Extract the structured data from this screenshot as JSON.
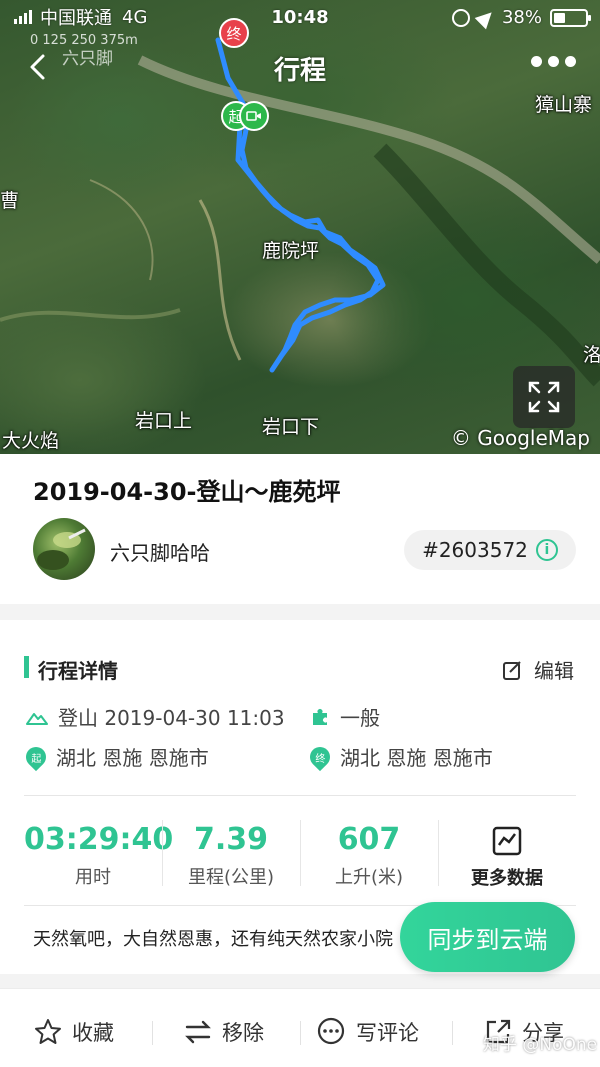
{
  "status_bar": {
    "carrier": "中国联通",
    "network": "4G",
    "time": "10:48",
    "battery": "38%",
    "battery_level": 0.38
  },
  "nav": {
    "title": "行程"
  },
  "map": {
    "scale_ticks": "0    125    250    375m",
    "scale_label": "六只脚",
    "places": [
      "獐山寨",
      "鹿院坪",
      "岩口上",
      "岩口下",
      "大火焰",
      "洛",
      "曹"
    ],
    "start_marker": "起",
    "end_marker": "终",
    "attribution": "© GoogleMap"
  },
  "trip": {
    "title": "2019-04-30-登山～鹿苑坪",
    "user_name": "六只脚哈哈",
    "trip_id": "#2603572"
  },
  "details": {
    "section_title": "行程详情",
    "edit_label": "编辑",
    "activity": "登山 2019-04-30 11:03",
    "difficulty": "一般",
    "start_location": "湖北 恩施 恩施市",
    "end_location": "湖北 恩施 恩施市",
    "start_badge": "起",
    "end_badge": "终",
    "stats": [
      {
        "value": "03:29:40",
        "label": "用时"
      },
      {
        "value": "7.39",
        "label": "里程(公里)"
      },
      {
        "value": "607",
        "label": "上升(米)"
      }
    ],
    "more_data_label": "更多数据",
    "note": "天然氧吧，大自然恩惠，还有纯天然农家小院"
  },
  "sync_button": "同步到云端",
  "bottom_bar": {
    "favorite": "收藏",
    "remove": "移除",
    "comment": "写评论",
    "share": "分享"
  },
  "watermark": "知乎 @NoOne",
  "colors": {
    "accent": "#2fc492",
    "route": "#2f8cff",
    "end_marker": "#e8414b",
    "start_marker": "#2db84b"
  }
}
